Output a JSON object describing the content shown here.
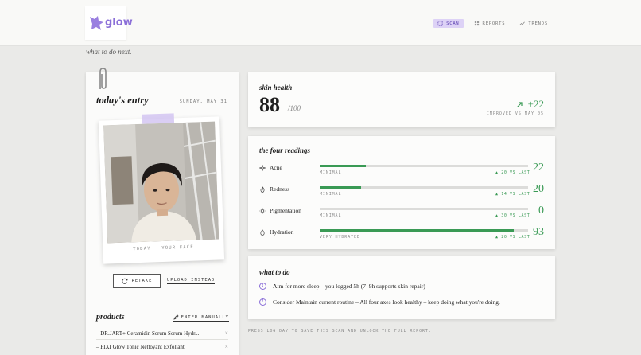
{
  "brand": {
    "name": "glow",
    "color": "#8b6fd8"
  },
  "nav": [
    {
      "label": "SCAN",
      "icon": "scan-icon",
      "active": true
    },
    {
      "label": "REPORTS",
      "icon": "grid-icon",
      "active": false
    },
    {
      "label": "TRENDS",
      "icon": "trend-icon",
      "active": false
    }
  ],
  "tagline": "what to do next.",
  "entry": {
    "title": "today's entry",
    "date": "SUNDAY, MAY 31",
    "photo_caption": "TODAY · YOUR FACE",
    "retake_label": "RETAKE",
    "upload_label": "UPLOAD INSTEAD"
  },
  "products": {
    "title": "products",
    "enter_manually_label": "ENTER MANUALLY",
    "items": [
      "– DR.JART+ Ceramidin Serum Serum Hydr...",
      "– PIXI Glow Tonic Nettoyant Exfoliant"
    ]
  },
  "health": {
    "title": "skin health",
    "score": "88",
    "denominator": "/100",
    "delta": "+22",
    "delta_note": "IMPROVED VS MAY 05"
  },
  "readings": {
    "title": "the four readings",
    "items": [
      {
        "name": "Acne",
        "icon": "sparkle-icon",
        "level": "MINIMAL",
        "vs": "▲ 20 VS LAST",
        "value": "22",
        "fill": 0.22
      },
      {
        "name": "Redness",
        "icon": "flame-icon",
        "level": "MINIMAL",
        "vs": "▲ 14 VS LAST",
        "value": "20",
        "fill": 0.2
      },
      {
        "name": "Pigmentation",
        "icon": "sun-icon",
        "level": "MINIMAL",
        "vs": "▲ 30 VS LAST",
        "value": "0",
        "fill": 0.0
      },
      {
        "name": "Hydration",
        "icon": "droplet-icon",
        "level": "VERY HYDRATED",
        "vs": "▲ 20 VS LAST",
        "value": "93",
        "fill": 0.93
      }
    ]
  },
  "todo": {
    "title": "what to do",
    "items": [
      "Aim for more sleep – you logged 5h (7–9h supports skin repair)",
      "Consider Maintain current routine – All four axes look healthy – keep doing what you're doing."
    ]
  },
  "footer_note": "PRESS LOG DAY TO SAVE THIS SCAN AND UNLOCK THE FULL REPORT.",
  "colors": {
    "accent": "#3a9a55",
    "nav_active_bg": "#ddd2f6",
    "page_bg": "#eaeae8"
  }
}
